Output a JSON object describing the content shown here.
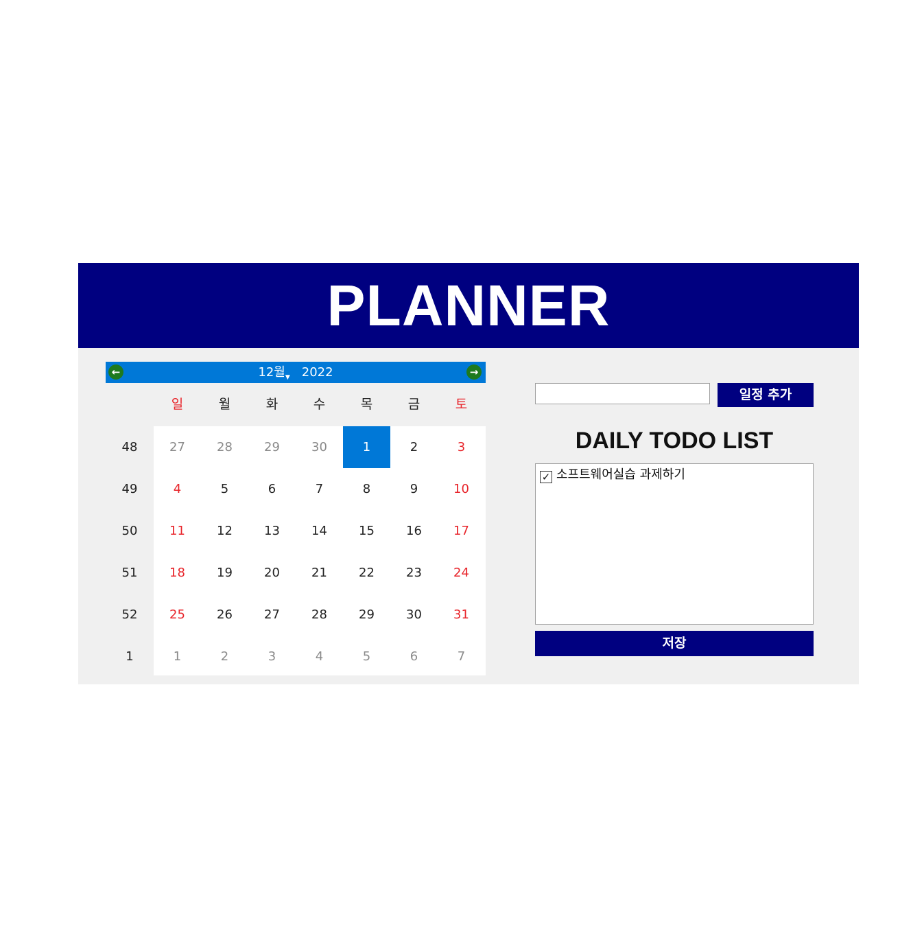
{
  "header": {
    "title": "PLANNER"
  },
  "calendar": {
    "month": "12월",
    "year": "2022",
    "prev_icon": "arrow-left-icon",
    "next_icon": "arrow-right-icon",
    "weekdays": [
      "일",
      "월",
      "화",
      "수",
      "목",
      "금",
      "토"
    ],
    "weeks": [
      {
        "num": "48",
        "days": [
          "27",
          "28",
          "29",
          "30",
          "1",
          "2",
          "3"
        ]
      },
      {
        "num": "49",
        "days": [
          "4",
          "5",
          "6",
          "7",
          "8",
          "9",
          "10"
        ]
      },
      {
        "num": "50",
        "days": [
          "11",
          "12",
          "13",
          "14",
          "15",
          "16",
          "17"
        ]
      },
      {
        "num": "51",
        "days": [
          "18",
          "19",
          "20",
          "21",
          "22",
          "23",
          "24"
        ]
      },
      {
        "num": "52",
        "days": [
          "25",
          "26",
          "27",
          "28",
          "29",
          "30",
          "31"
        ]
      },
      {
        "num": "1",
        "days": [
          "1",
          "2",
          "3",
          "4",
          "5",
          "6",
          "7"
        ]
      }
    ],
    "selected_day": "1",
    "colors": {
      "selected": "#0078d7",
      "weekend": "#e8252b",
      "muted": "#8a8a8a",
      "nav_bar": "#0078d7",
      "nav_button": "#1e7a1e"
    }
  },
  "todo": {
    "input_value": "",
    "add_label": "일정 추가",
    "title": "DAILY TODO LIST",
    "items": [
      {
        "text": "소프트웨어실습 과제하기",
        "checked": true
      }
    ],
    "save_label": "저장"
  },
  "colors": {
    "header": "#000080",
    "panel": "#f0f0f0"
  }
}
